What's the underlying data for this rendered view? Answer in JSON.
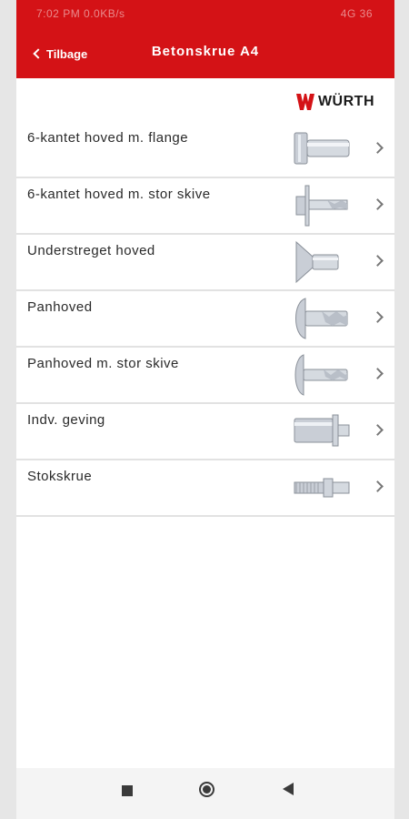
{
  "status_bar": {
    "left_text": "7:02 PM  0.0KB/s",
    "right_text": "4G  36"
  },
  "header": {
    "back_label": "Tilbage",
    "title": "Betonskrue A4"
  },
  "brand": {
    "name": "WÜRTH",
    "color": "#d41216"
  },
  "list": {
    "items": [
      {
        "label": "6-kantet hoved m. flange"
      },
      {
        "label": "6-kantet hoved m. stor skive"
      },
      {
        "label": "Understreget hoved"
      },
      {
        "label": "Panhoved"
      },
      {
        "label": "Panhoved m. stor skive"
      },
      {
        "label": "Indv. geving"
      },
      {
        "label": "Stokskrue"
      }
    ]
  },
  "nav": {
    "icons": [
      "stop-icon",
      "home-icon",
      "back-icon"
    ]
  },
  "colors": {
    "header": "#d41216",
    "divider": "#e2e2e2"
  }
}
